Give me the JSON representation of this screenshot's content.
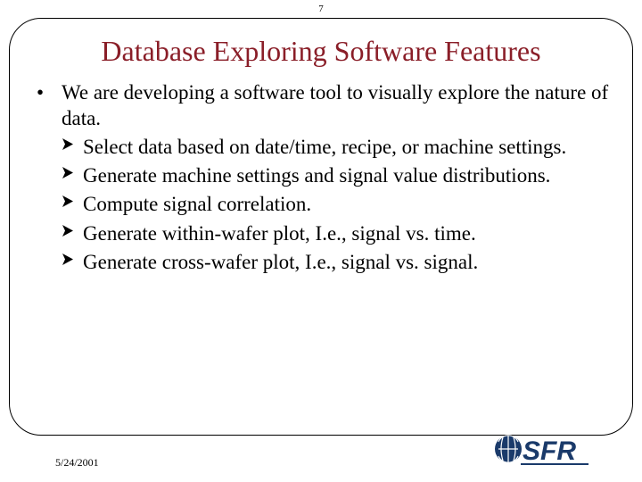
{
  "page_number": "7",
  "title": "Database Exploring Software Features",
  "main_bullet": "We are developing a software tool to visually explore the nature of data.",
  "sub_items": [
    "Select data based on date/time, recipe, or machine settings.",
    "Generate machine settings and signal value distributions.",
    "Compute signal correlation.",
    "Generate within-wafer plot, I.e., signal vs. time.",
    "Generate cross-wafer plot, I.e., signal vs. signal."
  ],
  "footer_date": "5/24/2001",
  "logo_text": "SFR"
}
